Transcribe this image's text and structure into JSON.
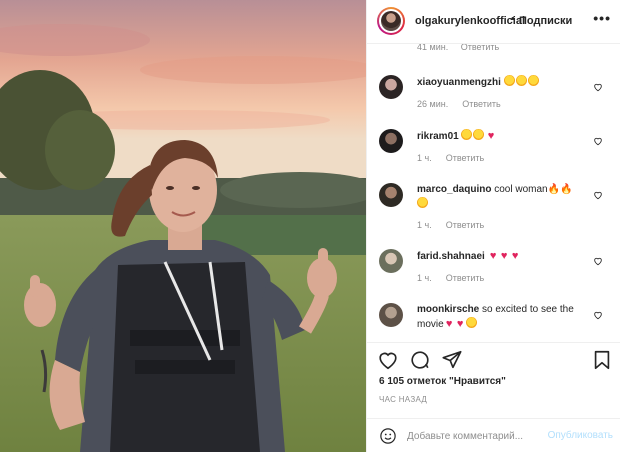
{
  "header": {
    "username": "olgakurylenkoofficial",
    "separator": "•",
    "follow_label": "Подписки",
    "more_label": "•••"
  },
  "comments": {
    "partial": {
      "time": "41 мин.",
      "reply": "Ответить"
    },
    "items": [
      {
        "username": "xiaoyuanmengzhi",
        "text": "",
        "emoji": [
          "face-heart-eyes",
          "face-heart-eyes",
          "face-heart-eyes"
        ],
        "time": "26 мин.",
        "reply": "Ответить"
      },
      {
        "username": "rikram01",
        "text": "",
        "emoji": [
          "face-heart-eyes",
          "face-heart-eyes",
          "heart"
        ],
        "time": "1 ч.",
        "reply": "Ответить"
      },
      {
        "username": "marco_daquino",
        "text": "cool woman",
        "emoji": [
          "fire",
          "fire",
          "face-heart-eyes"
        ],
        "time": "1 ч.",
        "reply": "Ответить"
      },
      {
        "username": "farid.shahnaei",
        "text": "",
        "emoji": [
          "heart",
          "heart",
          "heart"
        ],
        "time": "1 ч.",
        "reply": "Ответить"
      },
      {
        "username": "moonkirsche",
        "text": "so excited to see the movie",
        "emoji": [
          "heart",
          "heart",
          "face-heart-eyes"
        ],
        "time": "",
        "reply": ""
      }
    ]
  },
  "actions": {
    "like_icon": "heart-outline-icon",
    "comment_icon": "comment-bubble-icon",
    "share_icon": "paper-plane-icon",
    "save_icon": "bookmark-icon"
  },
  "likes_text": "6 105 отметок \"Нравится\"",
  "time_ago": "ЧАС НАЗАД",
  "composer": {
    "placeholder": "Добавьте комментарий...",
    "publish_label": "Опубликовать"
  },
  "colors": {
    "text": "#262626",
    "muted": "#8e8e8e",
    "publish_disabled": "#b2dffc",
    "heart_red": "#e0245e",
    "divider": "#efefef"
  }
}
